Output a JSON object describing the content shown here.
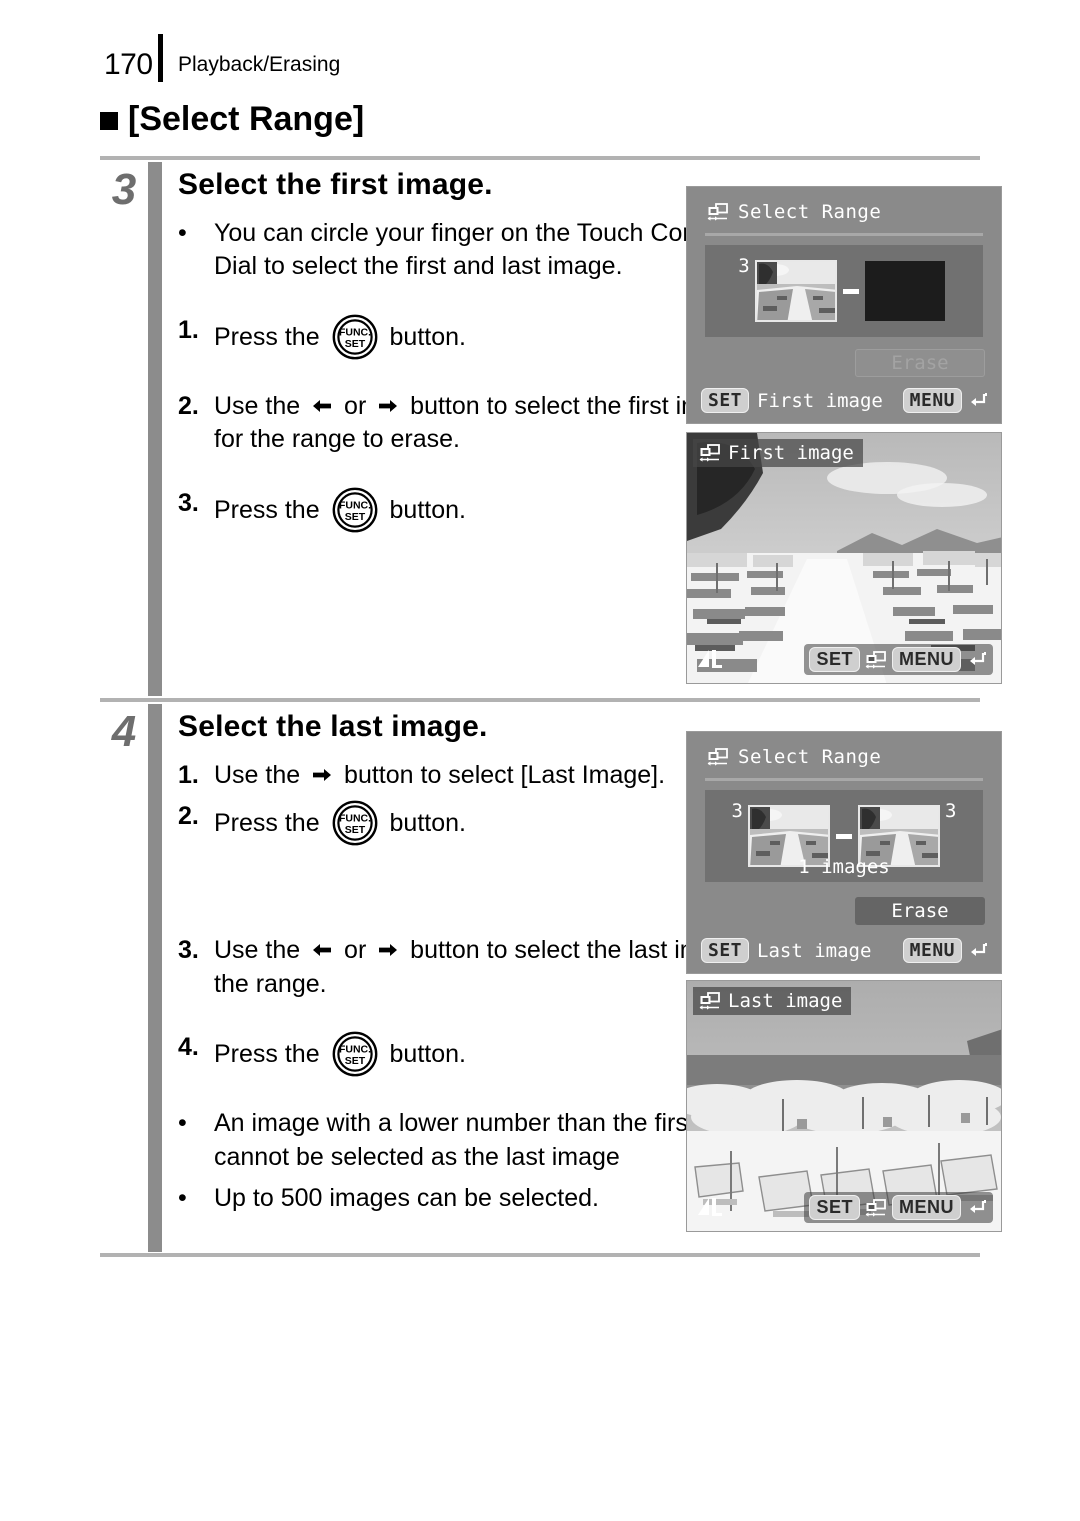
{
  "header": {
    "page_number": "170",
    "section": "Playback/Erasing"
  },
  "section_title": "[Select Range]",
  "steps": [
    {
      "number": "3",
      "heading": "Select the first image.",
      "items": [
        {
          "marker": "•",
          "type": "bullet",
          "text": "You can circle your finger on the Touch Control Dial to select the first and last image."
        },
        {
          "marker": "1.",
          "type": "num",
          "pre": "Press the ",
          "icon": "func-set-icon",
          "post": " button."
        },
        {
          "marker": "2.",
          "type": "num",
          "pre": "Use the ",
          "icon": "arrow-left-icon",
          "mid": " or ",
          "icon2": "arrow-right-icon",
          "post": " button to select the first image for the range to erase."
        },
        {
          "marker": "3.",
          "type": "num",
          "pre": "Press the ",
          "icon": "func-set-icon",
          "post": " button."
        }
      ]
    },
    {
      "number": "4",
      "heading": "Select the last image.",
      "items": [
        {
          "marker": "1.",
          "type": "num",
          "pre": "Use the ",
          "icon": "arrow-right-icon",
          "post": " button to select [Last Image]."
        },
        {
          "marker": "2.",
          "type": "num",
          "pre": "Press the ",
          "icon": "func-set-icon",
          "post": " button."
        },
        {
          "marker": "3.",
          "type": "num",
          "pre": "Use the ",
          "icon": "arrow-left-icon",
          "mid": " or ",
          "icon2": "arrow-right-icon",
          "post": " button to select the last image in the range."
        },
        {
          "marker": "4.",
          "type": "num",
          "pre": "Press the ",
          "icon": "func-set-icon",
          "post": " button."
        },
        {
          "marker": "•",
          "type": "bullet",
          "text": "An image with a lower number than the first image cannot be selected as the last image"
        },
        {
          "marker": "•",
          "type": "bullet",
          "text": "Up to 500 images can be selected."
        }
      ]
    }
  ],
  "screens": {
    "select_range_first": {
      "title": "Select Range",
      "title_icon": "select-range-icon",
      "first_thumb_number": "3",
      "second_thumb_number": "",
      "image_count": "",
      "erase_label": "Erase",
      "erase_state": "disabled",
      "footer_key": "SET",
      "footer_label": "First image",
      "menu_key": "MENU",
      "menu_icon": "return-arrow-icon"
    },
    "first_image_photo": {
      "badge_label": "First image",
      "badge_icon": "select-range-icon",
      "quality_icon": "large-fine-quality-icon",
      "ctrl_set": "SET",
      "ctrl_icon": "select-range-icon",
      "ctrl_menu": "MENU",
      "ctrl_return": "return-arrow-icon"
    },
    "select_range_last": {
      "title": "Select Range",
      "title_icon": "select-range-icon",
      "first_thumb_number": "3",
      "second_thumb_number": "3",
      "image_count": "1 images",
      "erase_label": "Erase",
      "erase_state": "enabled",
      "footer_key": "SET",
      "footer_label": "Last image",
      "menu_key": "MENU",
      "menu_icon": "return-arrow-icon"
    },
    "last_image_photo": {
      "badge_label": "Last image",
      "badge_icon": "select-range-icon",
      "quality_icon": "large-fine-quality-icon",
      "ctrl_set": "SET",
      "ctrl_icon": "select-range-icon",
      "ctrl_menu": "MENU",
      "ctrl_return": "return-arrow-icon"
    }
  },
  "colors": {
    "step_number": "#6e6e6e",
    "step_bar": "#8c8c8c",
    "rule": "#b2b2b2",
    "lcd_bg": "#8a8a8a",
    "lcd_panel": "#717171"
  }
}
